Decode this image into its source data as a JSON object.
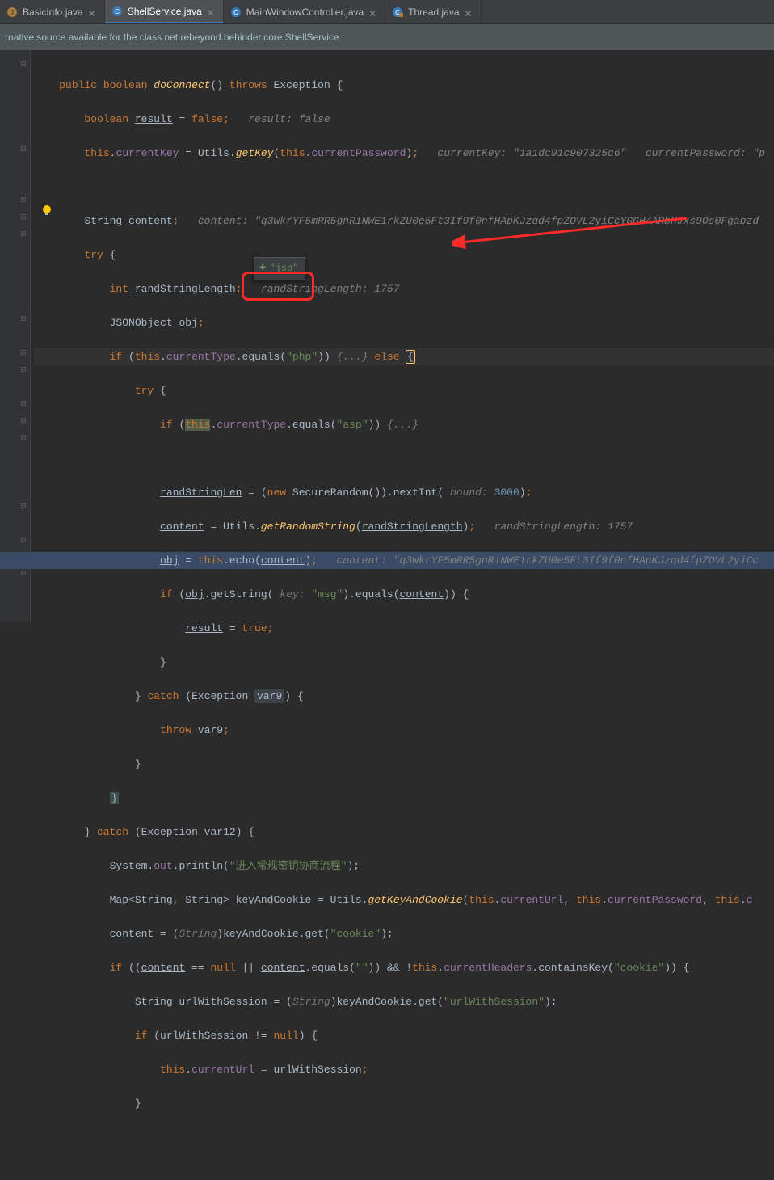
{
  "tabs": [
    {
      "label": "BasicInfo.java",
      "icon": "java",
      "active": false
    },
    {
      "label": "ShellService.java",
      "icon": "class",
      "active": true
    },
    {
      "label": "MainWindowController.java",
      "icon": "class",
      "active": false
    },
    {
      "label": "Thread.java",
      "icon": "class-lock",
      "active": false
    }
  ],
  "banner": "rnative source available for the class net.rebeyond.behinder.core.ShellService",
  "tooltip": {
    "plus": "+",
    "text": "\"jsp\""
  },
  "code": {
    "l1": {
      "kw1": "public",
      "kw2": "boolean",
      "m": "doConnect",
      "paren": "()",
      "kw3": "throws",
      "ex": "Exception",
      "br": "{"
    },
    "l2": {
      "kw": "boolean",
      "var": "result",
      "eq": " = ",
      "val": "false",
      "semi": ";",
      "hint": "   result: false"
    },
    "l3": {
      "this": "this",
      "dot1": ".",
      "f1": "currentKey",
      "eq": " = ",
      "cls": "Utils",
      "dot2": ".",
      "m": "getKey",
      "op": "(",
      "this2": "this",
      "dot3": ".",
      "f2": "currentPassword",
      "cl": ")",
      "semi": ";",
      "hint1": "   currentKey: \"1a1dc91c907325c6\"",
      "hint2": "   currentPassword: \"p"
    },
    "l5": {
      "t": "String ",
      "var": "content",
      "semi": ";",
      "hint": "   content: \"q3wkrYF5mRR5gnRiNWE1rkZU0e5Ft3If9f0nfHApKJzqd4fpZOVL2yiCcYGGH4ARbHJxs9Os0Fgabzd"
    },
    "l6": {
      "kw": "try",
      "br": " {"
    },
    "l7": {
      "kw": "int ",
      "var": "randStringLength",
      "semi": ";",
      "hint": "   randStringLength: 1757"
    },
    "l8": {
      "t": "JSONObject ",
      "var": "obj",
      "semi": ";"
    },
    "l9": {
      "kw": "if ",
      "op": "(",
      "this": "this",
      "dot": ".",
      "f": "currentType",
      "dot2": ".",
      "m": "equals",
      "op2": "(",
      "s": "\"php\"",
      "cl": "))",
      "fold": " {...} ",
      "el": "else ",
      "br": "{"
    },
    "l10": {
      "kw": "try ",
      "br": "{"
    },
    "l11": {
      "kw": "if ",
      "op": "(",
      "this": "this",
      "dot": ".",
      "f": "currentType",
      "dot2": ".",
      "m": "equals",
      "op2": "(",
      "s": "\"asp\"",
      "cl": "))",
      "fold": " {...}"
    },
    "l13": {
      "var": "randStringLen",
      "t1": " = (",
      "kw": "new ",
      "cls": "SecureRandom",
      "t2": "()).nextInt(",
      "hint": " bound: ",
      "num": "3000",
      "t3": ")",
      "semi": ";"
    },
    "l14": {
      "var": "content",
      "eq": " = ",
      "cls": "Utils",
      "dot": ".",
      "m": "getRandomString",
      "op": "(",
      "arg": "randStringLength",
      "cl": ")",
      "semi": ";",
      "hint": "   randStringLength: 1757"
    },
    "l15": {
      "var": "obj",
      "eq": " = ",
      "this": "this",
      "dot": ".",
      "m": "echo",
      "op": "(",
      "arg": "content",
      "cl": ")",
      "semi": ";",
      "hint": "   content: \"q3wkrYF5mRR5gnRiNWE1rkZU0e5Ft3If9f0nfHApKJzqd4fpZOVL2yiCc"
    },
    "l16": {
      "kw": "if ",
      "op": "(",
      "var": "obj",
      "dot": ".",
      "m": "getString",
      "op2": "(",
      "hint": " key: ",
      "s": "\"msg\"",
      "cl": ").equals(",
      "arg": "content",
      "cl2": ")) {"
    },
    "l17": {
      "var": "result",
      "eq": " = ",
      "val": "true",
      "semi": ";"
    },
    "l18": "}",
    "l19": {
      "br": "} ",
      "kw": "catch ",
      "op": "(",
      "t": "Exception ",
      "var": "var9",
      "cl": ") {"
    },
    "l20": {
      "kw": "throw ",
      "var": "var9",
      "semi": ";"
    },
    "l21": "}",
    "l22": "}",
    "l23": {
      "br": "} ",
      "kw": "catch ",
      "op": "(",
      "t": "Exception var12) {"
    },
    "l24": {
      "t1": "System.",
      "f": "out",
      "t2": ".println(",
      "s": "\"进入常规密钥协商流程\"",
      "t3": ");"
    },
    "l25": {
      "t1": "Map<String, String> keyAndCookie = Utils.",
      "m": "getKeyAndCookie",
      "op": "(",
      "this": "this",
      "dot": ".",
      "f1": "currentUrl",
      "c": ", ",
      "this2": "this",
      "dot2": ".",
      "f2": "currentPassword",
      "c2": ", ",
      "this3": "this",
      "dot3": ".",
      "f3": "c"
    },
    "l26": {
      "var": "content",
      "eq": " = (",
      "t": "String",
      "t2": ")keyAndCookie.get(",
      "s": "\"cookie\"",
      "t3": ");"
    },
    "l27": {
      "kw": "if ",
      "op": "((",
      "var": "content",
      "eq": " == ",
      "nul": "null",
      "or": " || ",
      "var2": "content",
      "m": ".equals(",
      "s": "\"\"",
      "cl": ")) && !",
      "this": "this",
      "dot": ".",
      "f": "currentHeaders",
      "m2": ".containsKey(",
      "s2": "\"cookie\"",
      "cl2": ")) {"
    },
    "l28": {
      "t1": "String urlWithSession = (",
      "t": "String",
      "t2": ")keyAndCookie.get(",
      "s": "\"urlWithSession\"",
      "t3": ");"
    },
    "l29": {
      "kw": "if ",
      "op": "(urlWithSession != ",
      "nul": "null",
      "cl": ") {"
    },
    "l30": {
      "this": "this",
      "dot": ".",
      "f": "currentUrl",
      "eq": " = urlWithSession",
      "semi": ";"
    },
    "l31": "}"
  }
}
